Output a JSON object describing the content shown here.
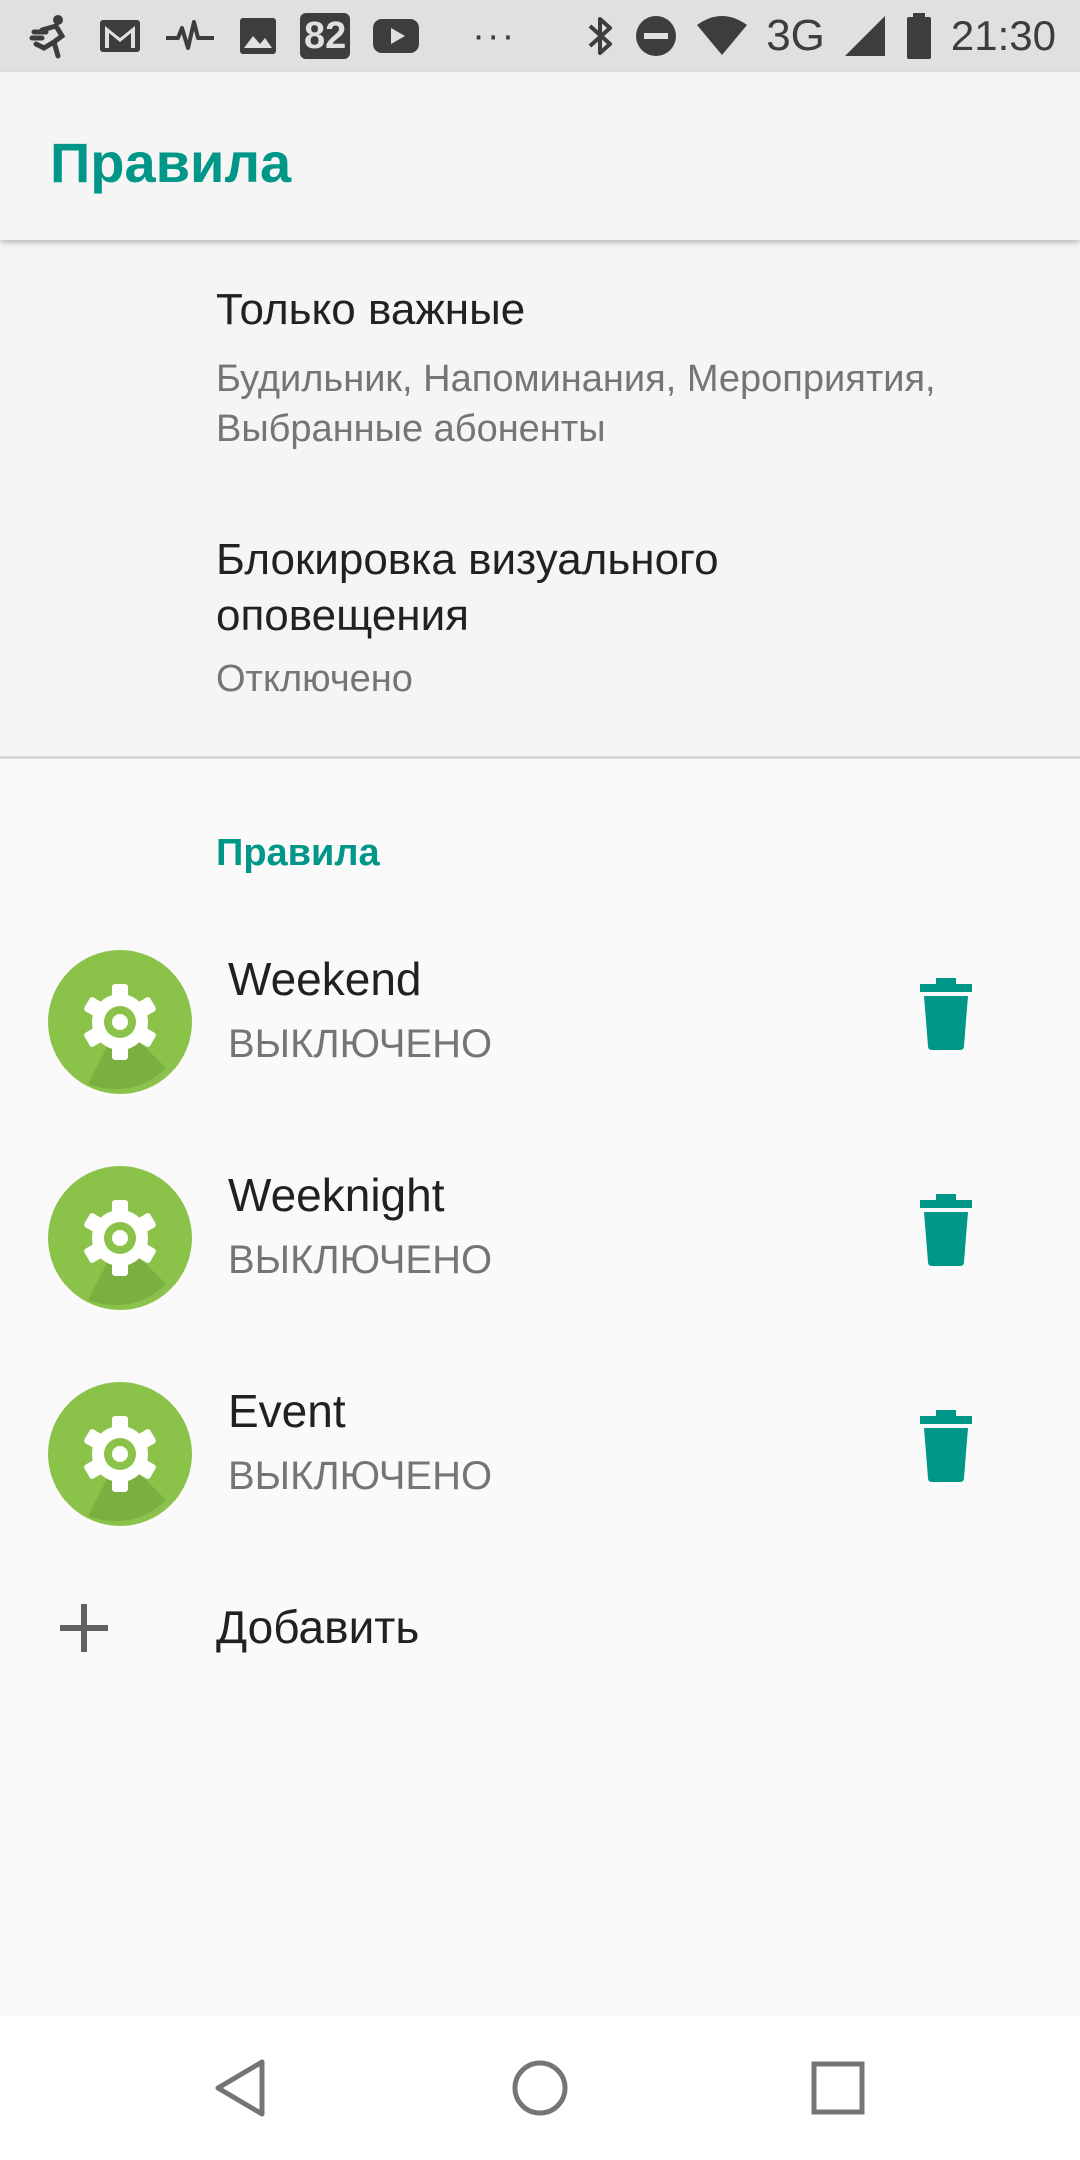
{
  "status_bar": {
    "icons": [
      "running-app-icon",
      "gmail-icon",
      "pulse-icon",
      "image-icon",
      "badge-82-icon",
      "youtube-icon",
      "more-dots-icon",
      "bluetooth-icon",
      "do-not-disturb-icon",
      "wifi-icon",
      "mobile-signal-icon",
      "battery-icon"
    ],
    "badge_text": "82",
    "more": "···",
    "network": "3G",
    "time": "21:30"
  },
  "app_bar": {
    "title": "Правила"
  },
  "preferences": {
    "priority_title": "Только важные",
    "priority_summary": "Будильник, Напоминания, Мероприятия, Выбранные абоненты",
    "visual_block_title": "Блокировка визуального оповещения",
    "visual_block_summary": "Отключено"
  },
  "rules_section": {
    "header": "Правила",
    "rules": [
      {
        "name": "Weekend",
        "status": "ВЫКЛЮЧЕНО",
        "icon": "gear-icon"
      },
      {
        "name": "Weeknight",
        "status": "ВЫКЛЮЧЕНО",
        "icon": "gear-icon"
      },
      {
        "name": "Event",
        "status": "ВЫКЛЮЧЕНО",
        "icon": "gear-icon"
      }
    ],
    "add_label": "Добавить"
  },
  "nav_bar": {
    "buttons": [
      "back-icon",
      "home-icon",
      "recents-icon"
    ]
  },
  "colors": {
    "accent": "#009688",
    "rule_icon_bg": "#8bc34a",
    "rule_icon_shadow": "#6f9f38",
    "primary_text": "#212121",
    "secondary_text": "#757575",
    "status_bar_bg": "#e0e0e0"
  }
}
